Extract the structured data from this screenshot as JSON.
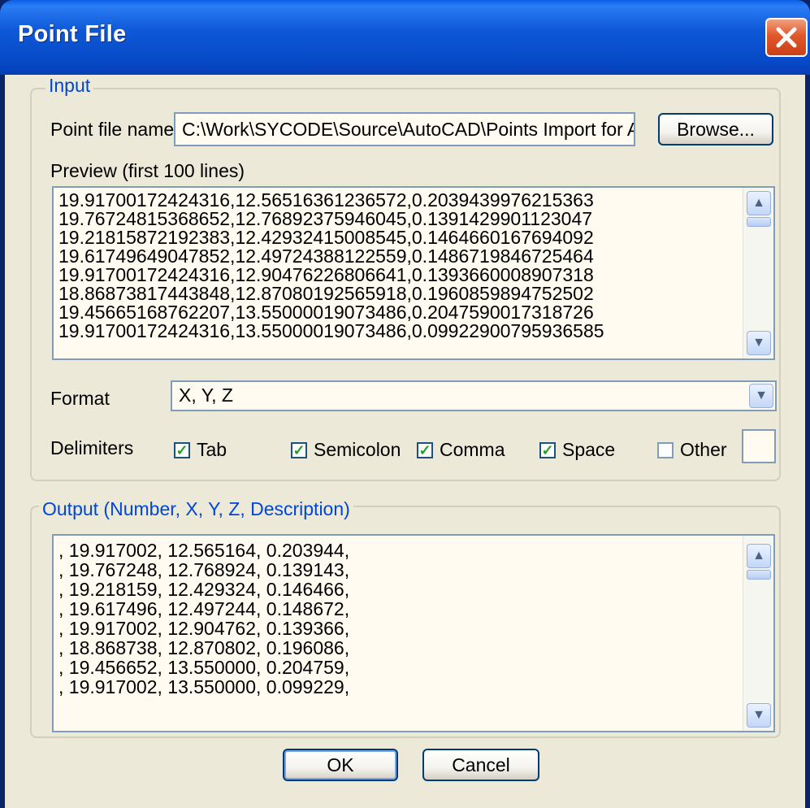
{
  "window": {
    "title": "Point File",
    "close_glyph": "✕"
  },
  "input_group": {
    "label": "Input",
    "point_file_label": "Point file name",
    "point_file_value": "C:\\Work\\SYCODE\\Source\\AutoCAD\\Points Import for Aut",
    "browse_label": "Browse...",
    "preview_label": "Preview (first 100 lines)",
    "preview_lines": [
      "19.91700172424316,12.56516361236572,0.2039439976215363",
      "19.76724815368652,12.76892375946045,0.1391429901123047",
      "19.21815872192383,12.42932415008545,0.1464660167694092",
      "19.61749649047852,12.49724388122559,0.1486719846725464",
      "19.91700172424316,12.90476226806641,0.1393660008907318",
      "18.86873817443848,12.87080192565918,0.1960859894752502",
      "19.45665168762207,13.55000019073486,0.2047590017318726",
      "19.91700172424316,13.55000019073486,0.09922900795936585"
    ],
    "format_label": "Format",
    "format_value": "X, Y, Z",
    "delimiters_label": "Delimiters",
    "delimiters": [
      {
        "label": "Tab",
        "checked": true
      },
      {
        "label": "Semicolon",
        "checked": true
      },
      {
        "label": "Comma",
        "checked": true
      },
      {
        "label": "Space",
        "checked": true
      },
      {
        "label": "Other",
        "checked": false
      }
    ],
    "other_value": ""
  },
  "output_group": {
    "label": "Output (Number, X, Y, Z, Description)",
    "lines": [
      ", 19.917002, 12.565164, 0.203944,",
      ", 19.767248, 12.768924, 0.139143,",
      ", 19.218159, 12.429324, 0.146466,",
      ", 19.617496, 12.497244, 0.148672,",
      ", 19.917002, 12.904762, 0.139366,",
      ", 18.868738, 12.870802, 0.196086,",
      ", 19.456652, 13.550000, 0.204759,",
      ", 19.917002, 13.550000, 0.099229,"
    ]
  },
  "buttons": {
    "ok_label": "OK",
    "cancel_label": "Cancel"
  },
  "scroll_glyphs": {
    "up": "▲",
    "down": "▼"
  },
  "colors": {
    "title_bar": "#0a5fe6",
    "group_label": "#0046d5",
    "field_bg": "#fffbf0",
    "dialog_bg": "#ece9d8"
  }
}
